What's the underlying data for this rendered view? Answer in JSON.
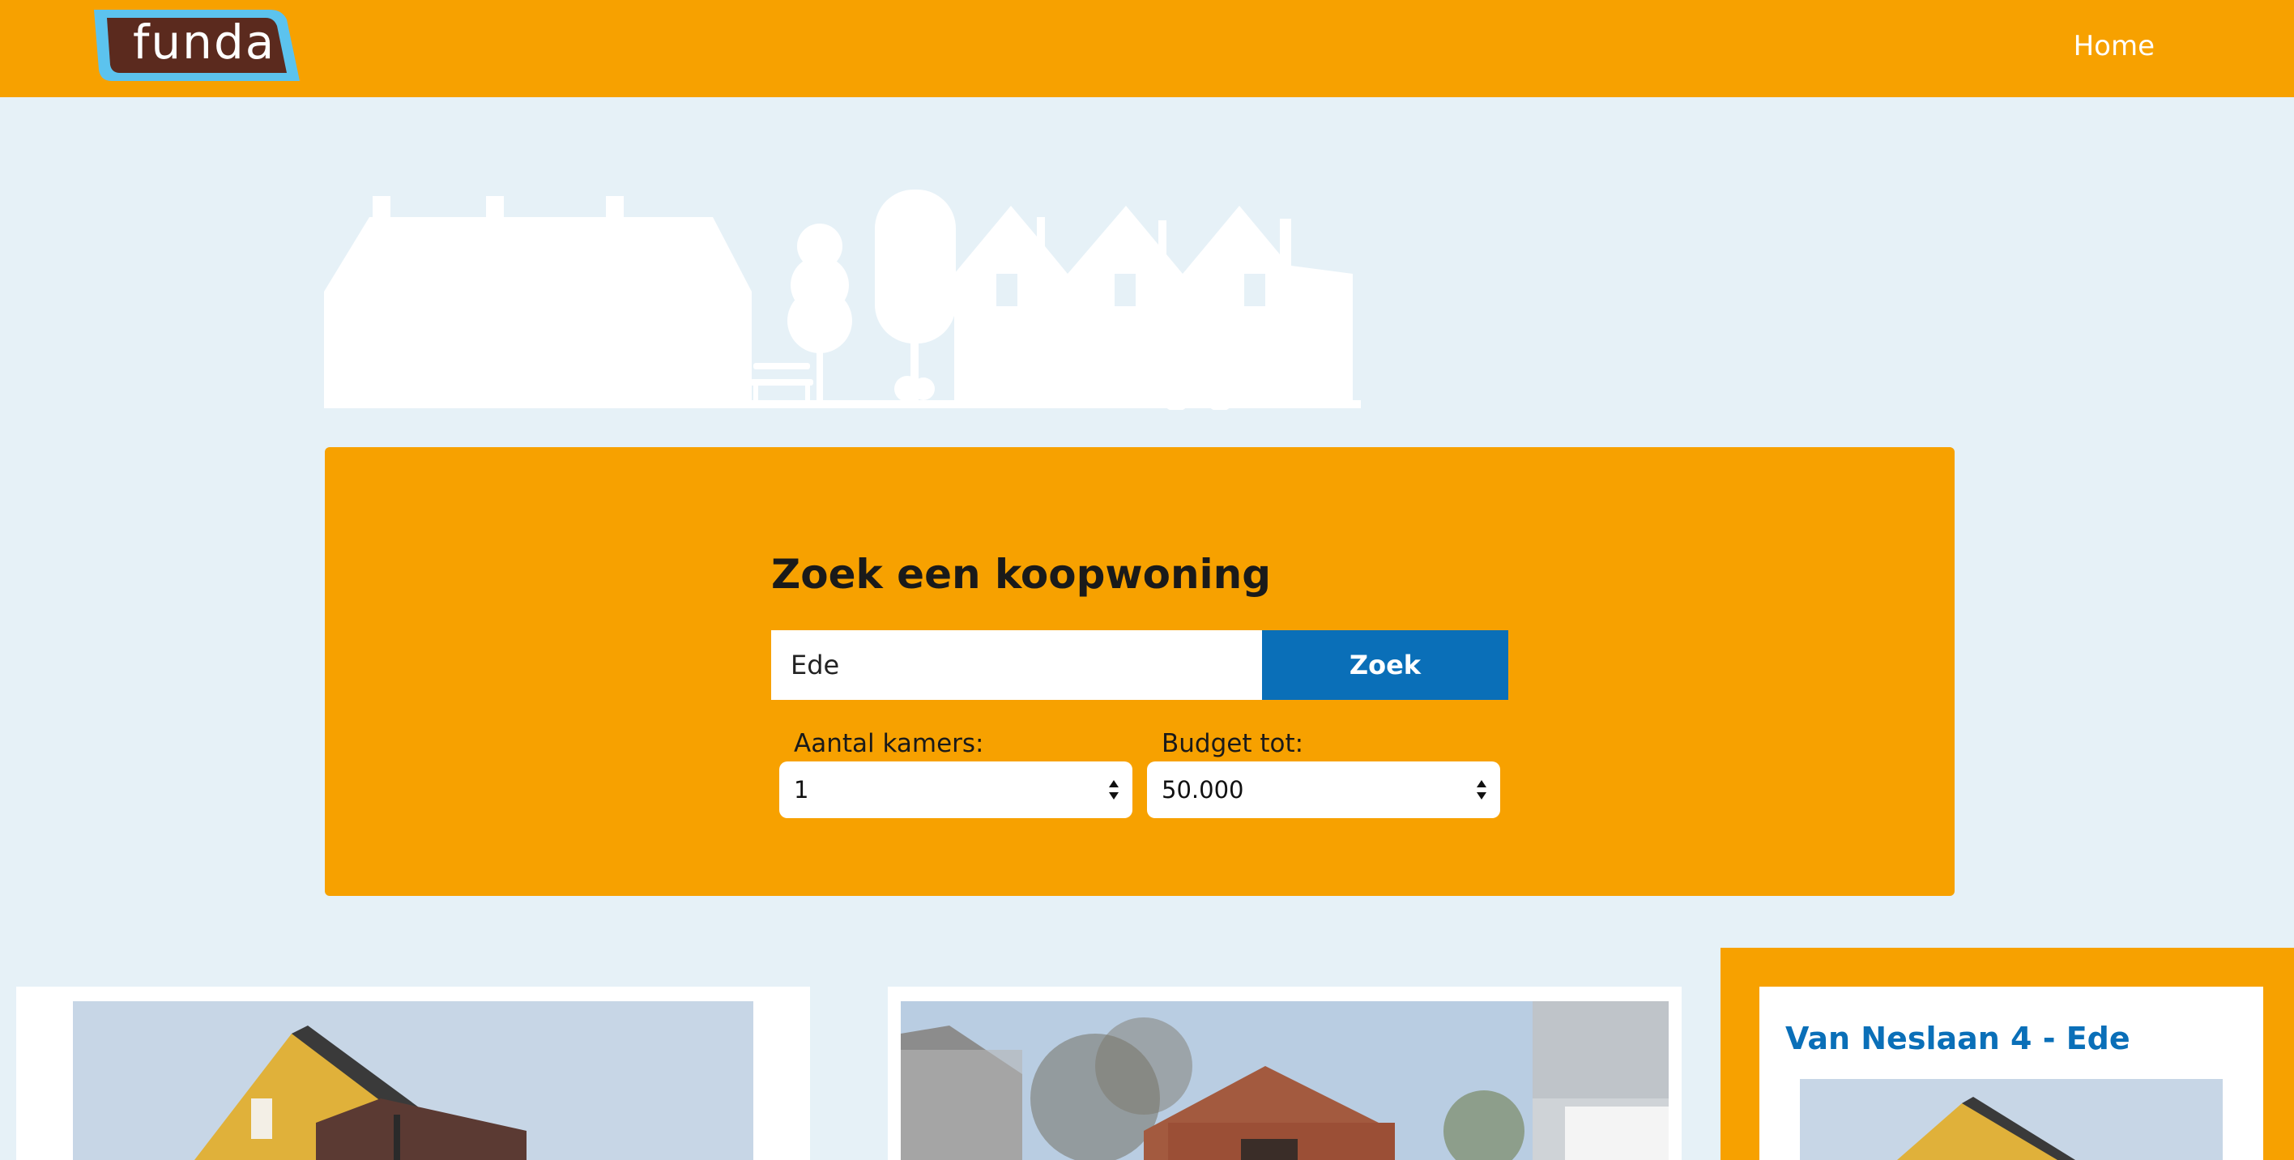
{
  "header": {
    "logo_text": "funda",
    "nav_home": "Home"
  },
  "search": {
    "title": "Zoek een koopwoning",
    "input_value": "Ede",
    "button_label": "Zoek",
    "rooms_label": "Aantal kamers:",
    "rooms_value": "1",
    "budget_label": "Budget tot:",
    "budget_value": "50.000"
  },
  "listings": [
    {
      "title": ""
    },
    {
      "title": ""
    },
    {
      "title": "Van Neslaan 4 - Ede",
      "featured": true
    }
  ],
  "colors": {
    "brand_orange": "#f7a100",
    "brand_blue": "#0a6fb8",
    "background": "#e6f1f7",
    "logo_brown": "#5b2a1e",
    "logo_light_blue": "#5cc3ee"
  }
}
